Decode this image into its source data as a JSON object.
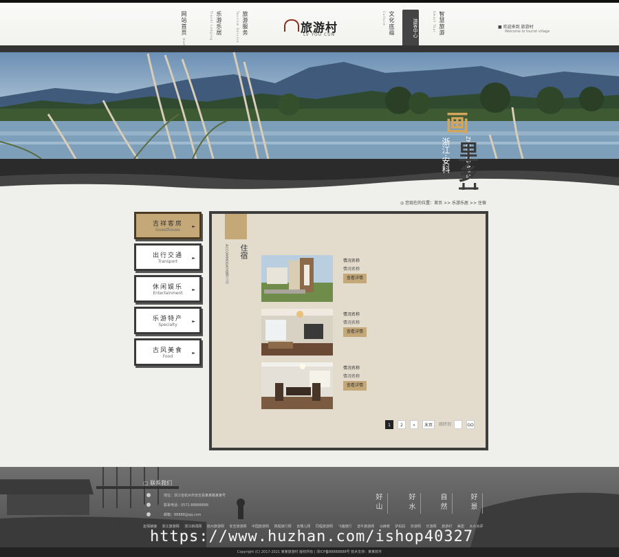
{
  "header": {
    "nav_left": [
      {
        "cn": "网站首页",
        "en": "Home"
      },
      {
        "cn": "乐游乐居",
        "en": "Travel Lodging"
      },
      {
        "cn": "旅游服务",
        "en": "Tourism Service"
      }
    ],
    "logo": {
      "name": "旅游村",
      "sub": "LV YOU CUN"
    },
    "nav_right": [
      {
        "cn": "文化底蕴",
        "en": "Culture"
      },
      {
        "cn": "乡里乡亲",
        "en": "Join Us"
      },
      {
        "cn": "智慧旅游",
        "en": "Smart Tour"
      }
    ],
    "active": "游客中心",
    "welcome": "欢迎来到 旅游村",
    "welcome_en": "Welcome to tourist village"
  },
  "banner": {
    "big1": "画",
    "big2": "里乡村",
    "small": "浙江·安科",
    "pinyin": "ZHEJIANG ANKE"
  },
  "breadcrumb": "您现在的位置：首页 >> 乐游乐居 >> 住宿",
  "sidebar": [
    {
      "cn": "吉祥客房",
      "en": "Guesthouse"
    },
    {
      "cn": "出行交通",
      "en": "Transport"
    },
    {
      "cn": "休闲娱乐",
      "en": "Entertainment"
    },
    {
      "cn": "乐游特产",
      "en": "Specialty"
    },
    {
      "cn": "古风美食",
      "en": "Food"
    }
  ],
  "panel": {
    "title": "住宿",
    "title_en": "ACCOMMODATION",
    "sub": "乐游乐居"
  },
  "items": [
    {
      "name": "情况名称",
      "desc": "情况名称",
      "more": "查看详情"
    },
    {
      "name": "情况名称",
      "desc": "情况名称",
      "more": "查看详情"
    },
    {
      "name": "情况名称",
      "desc": "情况名称",
      "more": "查看详情"
    }
  ],
  "pager": {
    "pages": [
      "1",
      "2"
    ],
    "next": "»",
    "last": "末页",
    "goto": "跳转到",
    "go": "GO"
  },
  "footer": {
    "contact_title": "联系我们",
    "address": "地址：浙江省杭州市安吉县某某路某某号",
    "phone": "联系电话：0571-88888888",
    "email": "邮箱：88888@qq.com",
    "cols": [
      "好山",
      "好水",
      "自然",
      "好景"
    ],
    "links": [
      "友情链接",
      "浙江旅游网",
      "浙江新闻网",
      "杭州旅游网",
      "安吉旅游网",
      "中国旅游网",
      "携程旅行网",
      "去哪儿网",
      "同程旅游网",
      "飞猪旅行",
      "途牛旅游网",
      "马蜂窝",
      "驴妈妈",
      "穷游网",
      "乐游网",
      "旅游村",
      "美团",
      "大众点评"
    ]
  },
  "copyright": "Copyright (C) 2017-2021 某某旅游村 版权所有 | 浙ICP备88888888号  技术支持：某某软件",
  "watermark": "https://www.huzhan.com/ishop40327"
}
